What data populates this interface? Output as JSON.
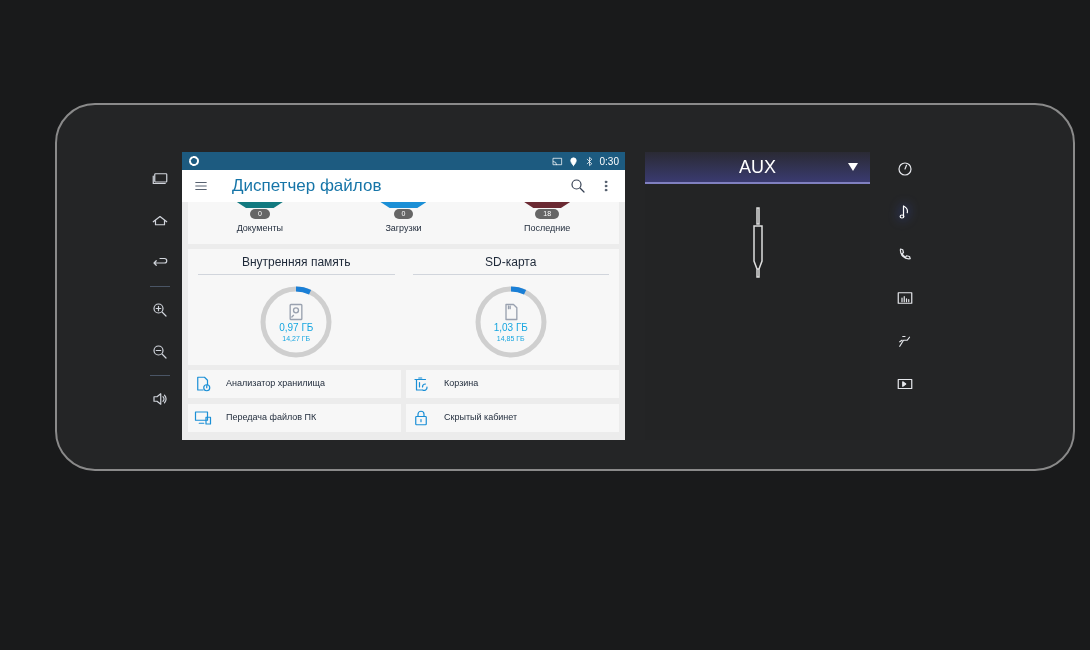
{
  "status_bar": {
    "time": "0:30"
  },
  "app": {
    "title": "Диспетчер файлов",
    "categories": [
      {
        "label": "Документы",
        "count": "0",
        "color": "#137a80"
      },
      {
        "label": "Загрузки",
        "count": "0",
        "color": "#1b8fd6"
      },
      {
        "label": "Последние",
        "count": "18",
        "color": "#6b2a33"
      }
    ],
    "storage": [
      {
        "kind": "internal",
        "title": "Внутренняя память",
        "used": "0,97 ГБ",
        "total": "14,27 ГБ",
        "level": 0.07
      },
      {
        "kind": "sd",
        "title": "SD-карта",
        "used": "1,03 ГБ",
        "total": "14,85 ГБ",
        "level": 0.07
      }
    ],
    "tools": [
      {
        "kind": "analyzer",
        "label": "Анализатор хранилища"
      },
      {
        "kind": "trash",
        "label": "Корзина"
      },
      {
        "kind": "pc",
        "label": "Передача файлов ПК"
      },
      {
        "kind": "lock",
        "label": "Скрытый кабинет"
      }
    ]
  },
  "aux": {
    "source": "AUX"
  },
  "side_menu": [
    {
      "kind": "gauge",
      "selected": false
    },
    {
      "kind": "music",
      "selected": true
    },
    {
      "kind": "phone",
      "selected": false
    },
    {
      "kind": "chart",
      "selected": false
    },
    {
      "kind": "seat",
      "selected": false
    },
    {
      "kind": "video",
      "selected": false
    }
  ]
}
